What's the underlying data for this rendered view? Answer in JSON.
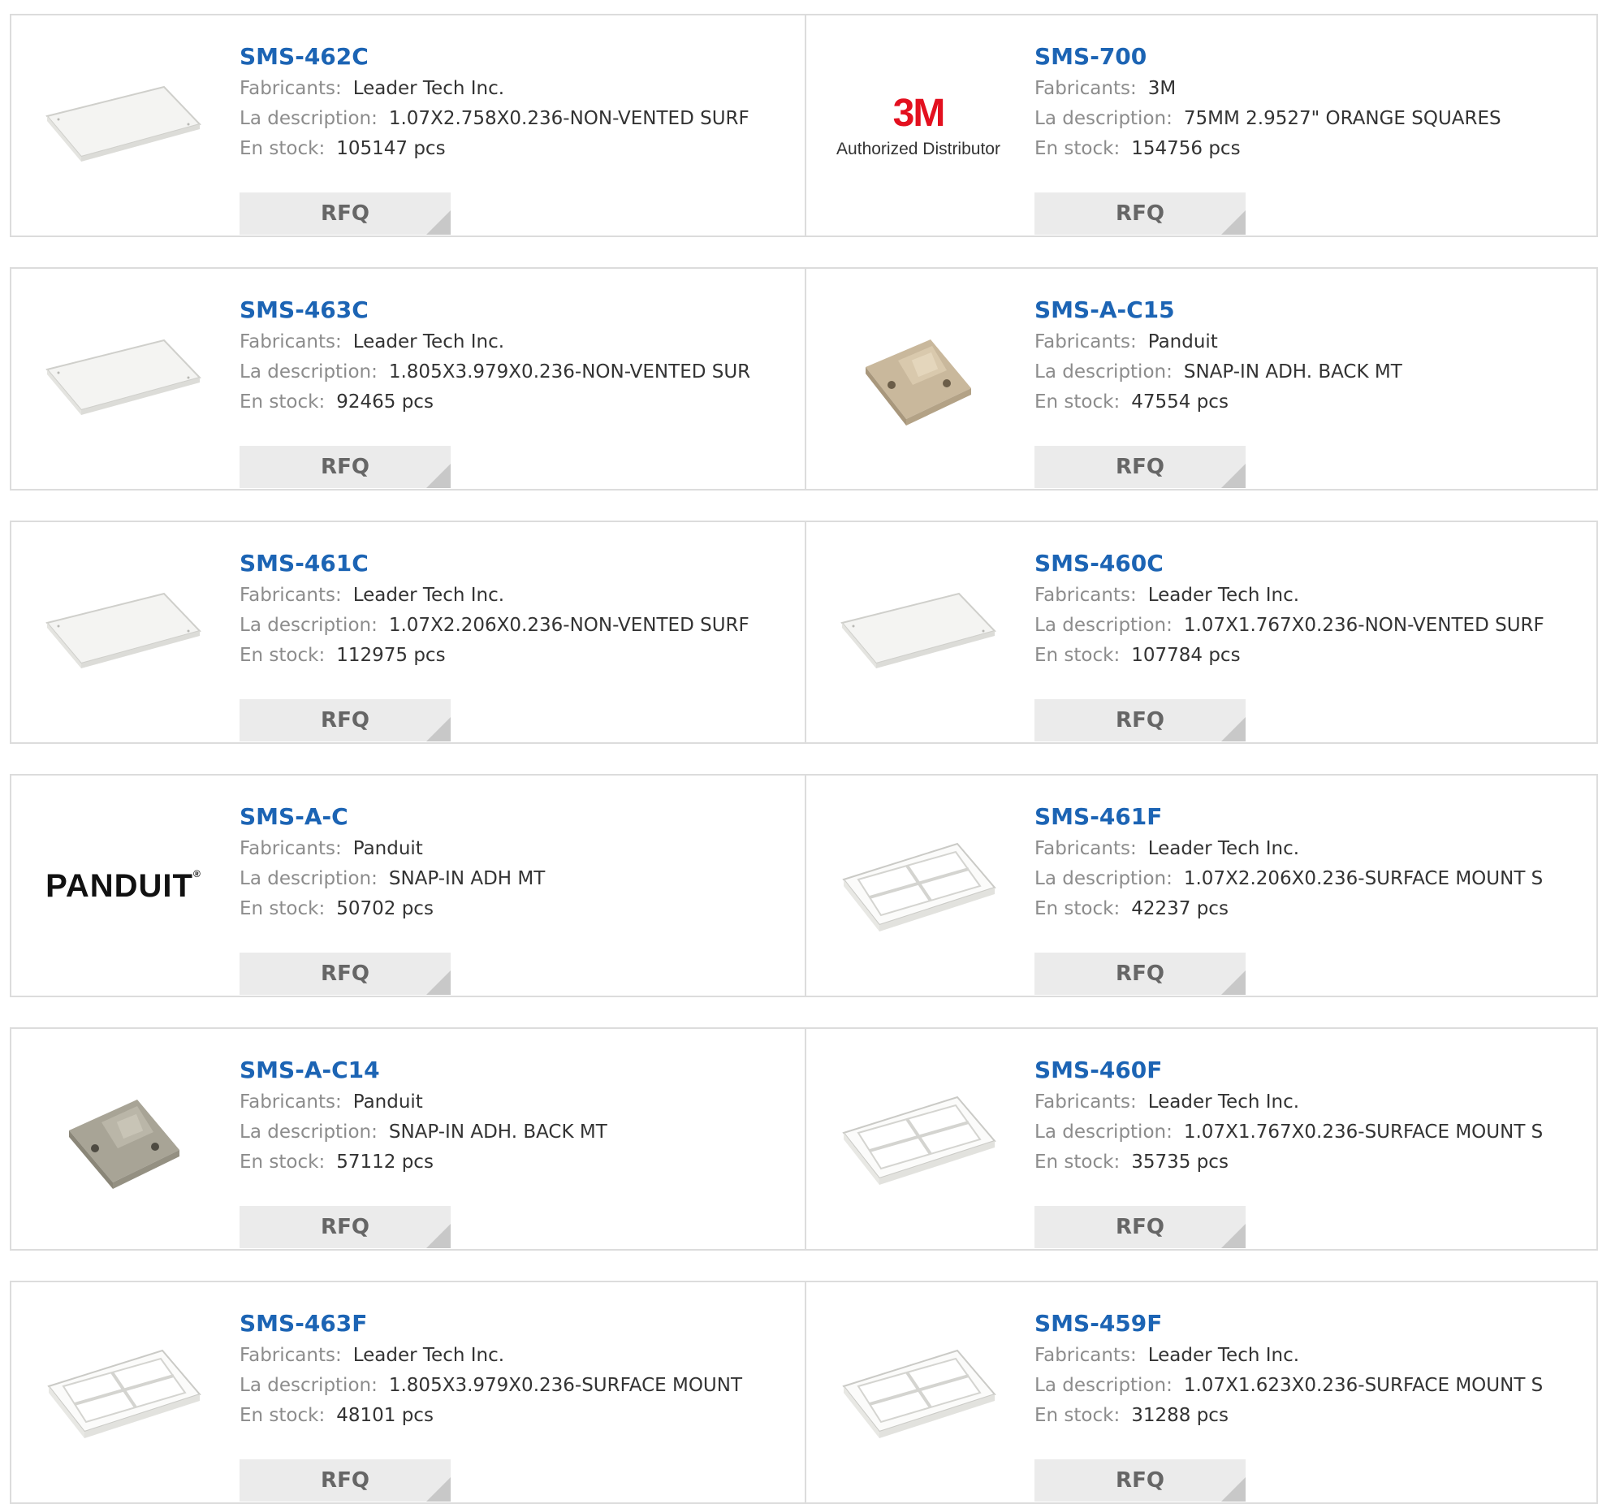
{
  "labels": {
    "manufacturer": "Fabricants:",
    "description": "La description:",
    "stock": "En stock:",
    "rfq": "RFQ"
  },
  "brands": {
    "three_m": {
      "mark": "3M",
      "sub": "Authorized Distributor",
      "color": "#e3101f"
    },
    "panduit": {
      "mark": "PANDUIT"
    }
  },
  "colors": {
    "part_link": "#1c64b4",
    "border": "#dcdcdc",
    "rfq_bg": "#ebebeb"
  },
  "products": [
    {
      "pn": "SMS-462C",
      "mfr": "Leader Tech Inc.",
      "desc": "1.07X2.758X0.236-NON-VENTED SURF",
      "stock": "105147 pcs",
      "image": "flat-cover-plate"
    },
    {
      "pn": "SMS-700",
      "mfr": "3M",
      "desc": "75MM 2.9527\" ORANGE SQUARES",
      "stock": "154756 pcs",
      "image": "3m-logo"
    },
    {
      "pn": "SMS-463C",
      "mfr": "Leader Tech Inc.",
      "desc": "1.805X3.979X0.236-NON-VENTED SUR",
      "stock": "92465 pcs",
      "image": "flat-cover-plate"
    },
    {
      "pn": "SMS-A-C15",
      "mfr": "Panduit",
      "desc": "SNAP-IN ADH. BACK MT",
      "stock": "47554 pcs",
      "image": "tie-mount-tan"
    },
    {
      "pn": "SMS-461C",
      "mfr": "Leader Tech Inc.",
      "desc": "1.07X2.206X0.236-NON-VENTED SURF",
      "stock": "112975 pcs",
      "image": "flat-cover-plate"
    },
    {
      "pn": "SMS-460C",
      "mfr": "Leader Tech Inc.",
      "desc": "1.07X1.767X0.236-NON-VENTED SURF",
      "stock": "107784 pcs",
      "image": "flat-cover-plate"
    },
    {
      "pn": "SMS-A-C",
      "mfr": "Panduit",
      "desc": "SNAP-IN ADH MT",
      "stock": "50702 pcs",
      "image": "panduit-logo"
    },
    {
      "pn": "SMS-461F",
      "mfr": "Leader Tech Inc.",
      "desc": "1.07X2.206X0.236-SURFACE MOUNT S",
      "stock": "42237 pcs",
      "image": "shield-frame"
    },
    {
      "pn": "SMS-A-C14",
      "mfr": "Panduit",
      "desc": "SNAP-IN ADH. BACK MT",
      "stock": "57112 pcs",
      "image": "tie-mount-gray"
    },
    {
      "pn": "SMS-460F",
      "mfr": "Leader Tech Inc.",
      "desc": "1.07X1.767X0.236-SURFACE MOUNT S",
      "stock": "35735 pcs",
      "image": "shield-frame"
    },
    {
      "pn": "SMS-463F",
      "mfr": "Leader Tech Inc.",
      "desc": "1.805X3.979X0.236-SURFACE MOUNT",
      "stock": "48101 pcs",
      "image": "shield-frame"
    },
    {
      "pn": "SMS-459F",
      "mfr": "Leader Tech Inc.",
      "desc": "1.07X1.623X0.236-SURFACE MOUNT S",
      "stock": "31288 pcs",
      "image": "shield-frame"
    }
  ]
}
